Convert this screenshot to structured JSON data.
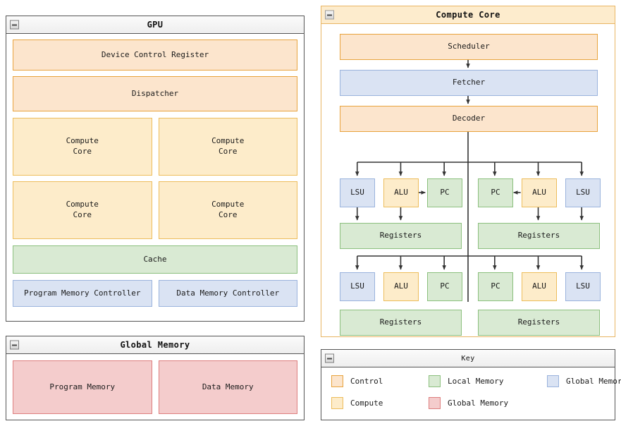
{
  "gpu_panel": {
    "title": "GPU",
    "collapse_icon": "collapse-minus-icon",
    "device_control_register": "Device Control Register",
    "dispatcher": "Dispatcher",
    "compute_cores": [
      "Compute\nCore",
      "Compute\nCore",
      "Compute\nCore",
      "Compute\nCore"
    ],
    "cache": "Cache",
    "memory_controllers": [
      "Program Memory Controller",
      "Data Memory Controller"
    ]
  },
  "global_memory_panel": {
    "title": "Global Memory",
    "collapse_icon": "collapse-minus-icon",
    "blocks": [
      "Program Memory",
      "Data Memory"
    ]
  },
  "compute_core_panel": {
    "title": "Compute Core",
    "collapse_icon": "collapse-minus-icon",
    "scheduler": "Scheduler",
    "fetcher": "Fetcher",
    "decoder": "Decoder",
    "threads": [
      {
        "row": 1,
        "left": {
          "units": [
            "LSU",
            "ALU",
            "PC"
          ],
          "registers": "Registers"
        },
        "right": {
          "units": [
            "PC",
            "ALU",
            "LSU"
          ],
          "registers": "Registers"
        }
      },
      {
        "row": 2,
        "left": {
          "units": [
            "LSU",
            "ALU",
            "PC"
          ],
          "registers": "Registers"
        },
        "right": {
          "units": [
            "PC",
            "ALU",
            "LSU"
          ],
          "registers": "Registers"
        }
      }
    ]
  },
  "key_panel": {
    "title": "Key",
    "collapse_icon": "collapse-minus-icon",
    "entries": [
      {
        "label": "Control",
        "fill": "#fce5cd",
        "stroke": "#e8a33d"
      },
      {
        "label": "Local Memory",
        "fill": "#d9ead3",
        "stroke": "#8cc07e"
      },
      {
        "label": "Global Memory Access",
        "fill": "#dae3f3",
        "stroke": "#9ab3dd"
      },
      {
        "label": "Compute",
        "fill": "#fdecca",
        "stroke": "#edbd5c"
      },
      {
        "label": "Global Memory",
        "fill": "#f4cccc",
        "stroke": "#dd7e7e"
      }
    ]
  }
}
